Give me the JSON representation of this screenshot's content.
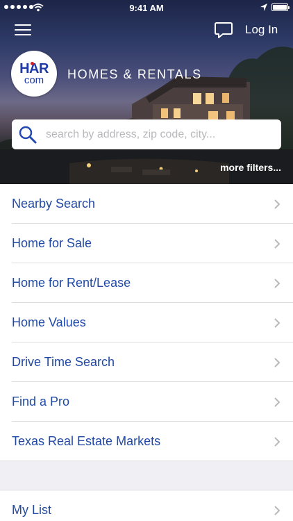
{
  "status_bar": {
    "time": "9:41 AM"
  },
  "header": {
    "login_label": "Log In"
  },
  "logo": {
    "line1": "HAR",
    "line2": "com"
  },
  "brand": {
    "title": "HOMES & RENTALS"
  },
  "search": {
    "placeholder": "search by address, zip code, city...",
    "more_filters": "more filters..."
  },
  "menu": {
    "items": [
      {
        "label": "Nearby Search"
      },
      {
        "label": "Home for Sale"
      },
      {
        "label": "Home for Rent/Lease"
      },
      {
        "label": "Home Values"
      },
      {
        "label": "Drive Time Search"
      },
      {
        "label": "Find a Pro"
      },
      {
        "label": "Texas Real Estate Markets"
      }
    ],
    "secondary_items": [
      {
        "label": "My List"
      }
    ]
  },
  "colors": {
    "link_blue": "#2049a6",
    "logo_blue": "#1e3aa8",
    "logo_red": "#d31f26"
  },
  "icons": [
    "hamburger-icon",
    "chat-bubble-icon",
    "search-icon",
    "chevron-right-icon",
    "wifi-icon",
    "location-arrow-icon",
    "battery-icon"
  ]
}
